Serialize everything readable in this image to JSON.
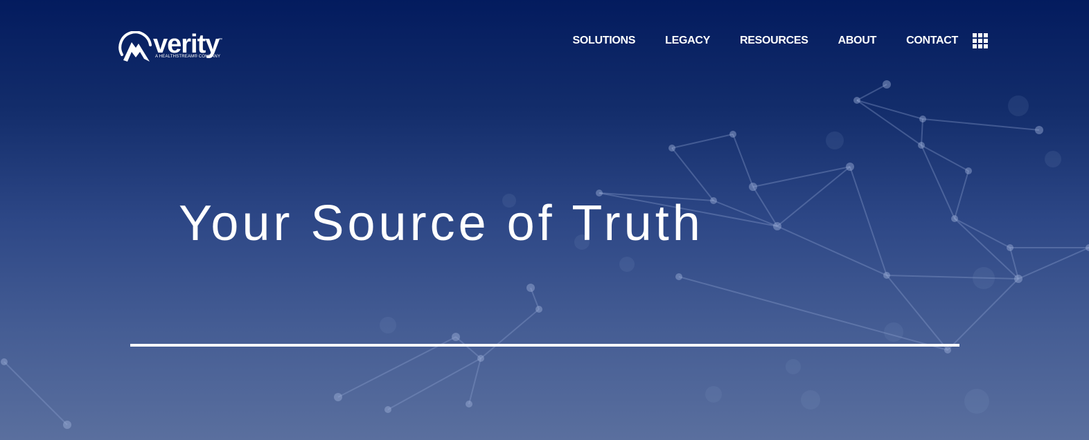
{
  "brand": {
    "name": "verity",
    "trademark": "™",
    "tagline": "A HEALTHSTREAM® COMPANY"
  },
  "nav": {
    "items": [
      {
        "label": "SOLUTIONS"
      },
      {
        "label": "LEGACY"
      },
      {
        "label": "RESOURCES"
      },
      {
        "label": "ABOUT"
      },
      {
        "label": "CONTACT"
      }
    ],
    "menu_icon": "grid-menu-icon"
  },
  "hero": {
    "title": "Your Source of Truth"
  },
  "colors": {
    "background_top": "#031b5e",
    "background_bottom": "#5a6f9e",
    "text": "#ffffff",
    "network_lines": "#8fa3d1"
  }
}
